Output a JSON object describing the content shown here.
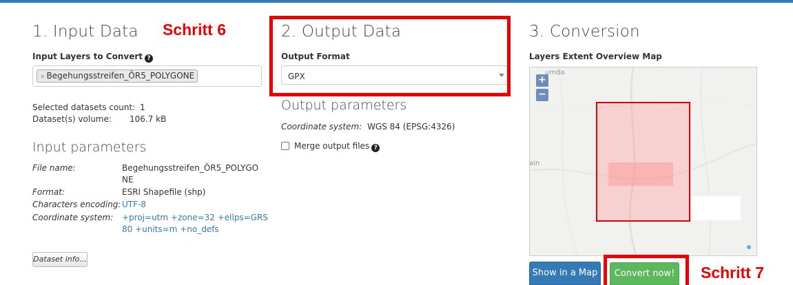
{
  "input": {
    "heading": "1. Input Data",
    "layers_label": "Input Layers to Convert",
    "layer_tag": "Begehungsstreifen_ÖR5_POLYGONE",
    "tag_remove": "×",
    "count_label": "Selected datasets count:",
    "count_value": "1",
    "volume_label": "Dataset(s) volume:",
    "volume_value": "106.7 kB",
    "params_heading": "Input parameters",
    "file_name_label": "File name:",
    "file_name_line1": "Begehungsstreifen_ÖR5_POLYGO",
    "file_name_line2": "NE",
    "format_label": "Format:",
    "format_value": "ESRI Shapefile (shp)",
    "encoding_label": "Characters encoding:",
    "encoding_value": "UTF-8",
    "coord_label": "Coordinate system:",
    "coord_line1": "+proj=utm +zone=32 +ellps=GRS",
    "coord_line2": "80 +units=m +no_defs",
    "dataset_info_button": "Dataset info..."
  },
  "output": {
    "heading": "2. Output Data",
    "format_label": "Output Format",
    "format_value": "GPX",
    "params_heading": "Output parameters",
    "coord_label": "Coordinate system:",
    "coord_value": "WGS 84 (EPSG:4326)",
    "merge_label": "Merge output files",
    "merge_checked": false
  },
  "conversion": {
    "heading": "3. Conversion",
    "map_label": "Layers Extent Overview Map",
    "zoom_in": "+",
    "zoom_out": "−",
    "map_place_top": "umda",
    "map_place_left": "ain",
    "show_map_button": "Show in a Map",
    "convert_button": "Convert now!"
  },
  "annotations": {
    "step6": "Schritt 6",
    "step7": "Schritt 7"
  },
  "icons": {
    "help": "?"
  },
  "colors": {
    "annotation_red": "#ee0000",
    "primary_blue": "#337ab7",
    "success_green": "#5cb85c"
  }
}
